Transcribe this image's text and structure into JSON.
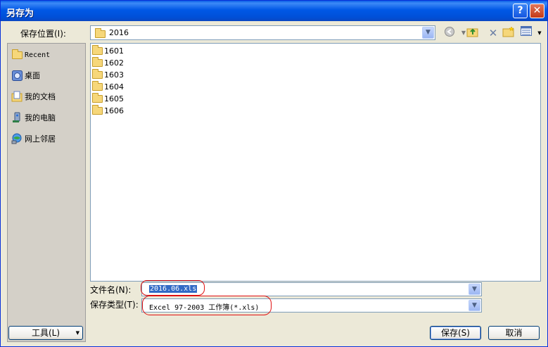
{
  "window": {
    "title": "另存为"
  },
  "titlebar_buttons": {
    "help": "?",
    "close": "✕"
  },
  "save_in": {
    "label": "保存位置(I):",
    "value": "2016"
  },
  "toolbar": {
    "icons": [
      "back-icon",
      "up-folder-icon",
      "delete-icon",
      "new-folder-icon",
      "view-menu-icon"
    ]
  },
  "places": [
    {
      "label": "Recent",
      "icon": "recent-folder-icon"
    },
    {
      "label": "桌面",
      "icon": "desktop-icon"
    },
    {
      "label": "我的文档",
      "icon": "my-documents-icon"
    },
    {
      "label": "我的电脑",
      "icon": "my-computer-icon"
    },
    {
      "label": "网上邻居",
      "icon": "network-icon"
    }
  ],
  "files": [
    "1601",
    "1602",
    "1603",
    "1604",
    "1605",
    "1606"
  ],
  "file_name": {
    "label": "文件名(N):",
    "value": "2016.06.xls"
  },
  "file_type": {
    "label": "保存类型(T):",
    "value": "Excel 97-2003 工作簿(*.xls)"
  },
  "buttons": {
    "tools": "工具(L)",
    "save": "保存(S)",
    "cancel": "取消"
  },
  "colors": {
    "titlebar": "#0058e6",
    "highlight_ring": "#e01010",
    "selection": "#316ac5"
  }
}
